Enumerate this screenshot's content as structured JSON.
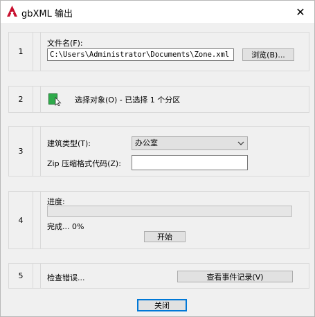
{
  "window": {
    "title": "gbXML 输出",
    "close_glyph": "✕",
    "app_icon": "autocad-a-icon",
    "accent": "#c8102e"
  },
  "sections": {
    "s1": {
      "number": "1",
      "filename_label": "文件名(F):",
      "filename_value": "C:\\Users\\Administrator\\Documents\\Zone.xml",
      "browse_label": "浏览(B)..."
    },
    "s2": {
      "number": "2",
      "select_icon": "select-objects-icon",
      "select_text": "选择对象(O) - 已选择 1 个分区"
    },
    "s3": {
      "number": "3",
      "building_type_label": "建筑类型(T):",
      "building_type_value": "办公室",
      "zip_label": "Zip 压缩格式代码(Z):",
      "zip_value": ""
    },
    "s4": {
      "number": "4",
      "progress_label": "进度:",
      "progress_fraction": 0,
      "complete_text": "完成... 0%",
      "start_label": "开始"
    },
    "s5": {
      "number": "5",
      "check_errors_label": "检查错误...",
      "view_log_label": "查看事件记录(V)"
    }
  },
  "footer": {
    "close_label": "关闭"
  }
}
